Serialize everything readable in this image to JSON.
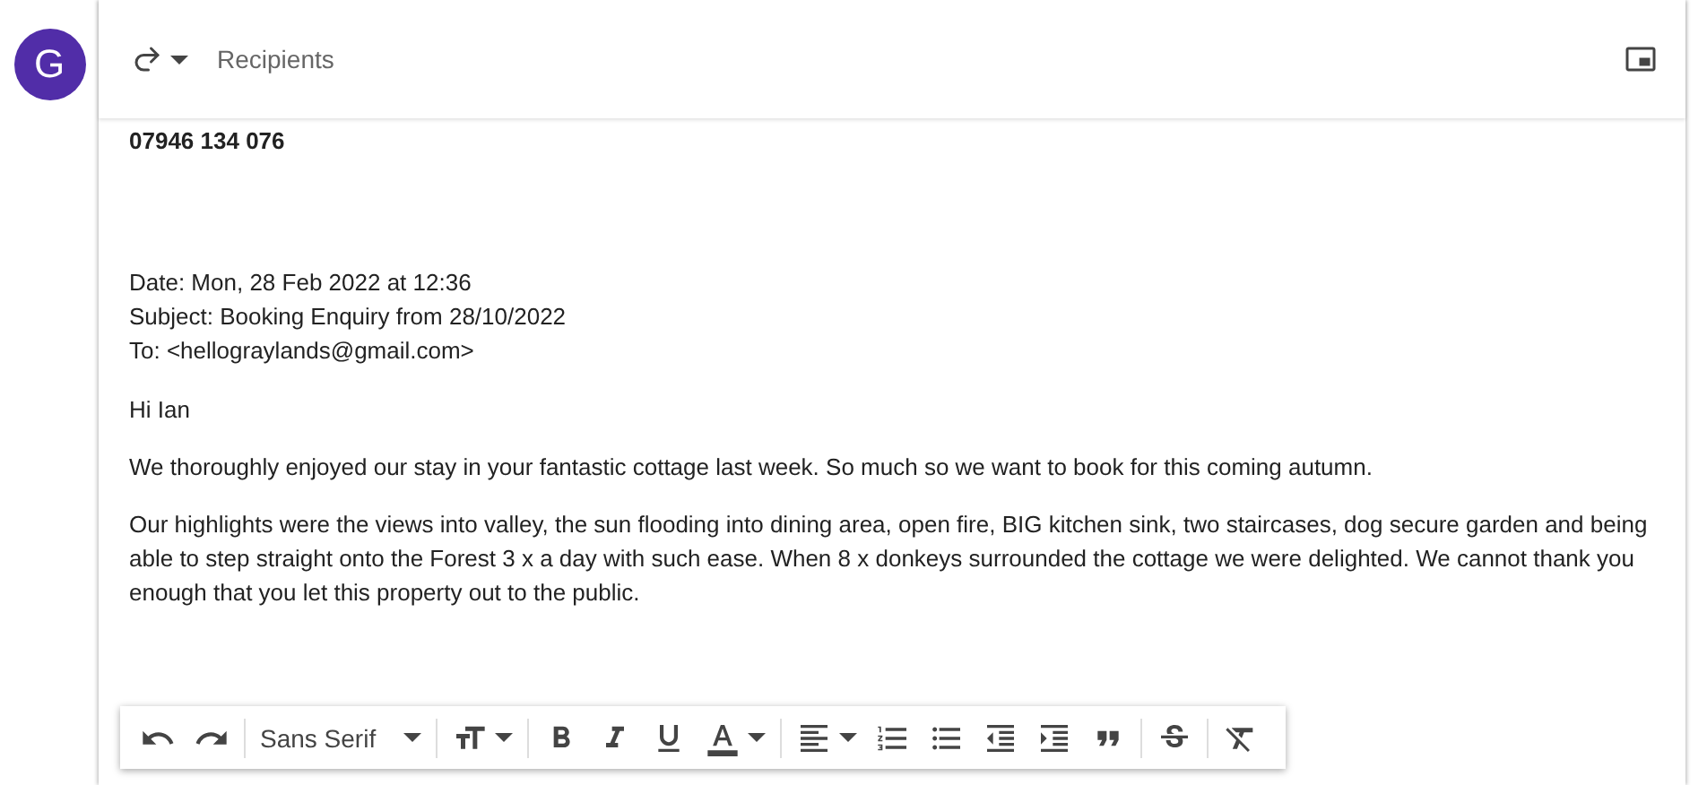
{
  "avatar": {
    "initial": "G"
  },
  "header": {
    "recipients_placeholder": "Recipients"
  },
  "body": {
    "phone": "07946 134 076",
    "meta": [
      "Date: Mon, 28 Feb 2022 at 12:36",
      "Subject: Booking Enquiry from 28/10/2022",
      "To: <hellograylands@gmail.com>"
    ],
    "paragraphs": [
      "Hi Ian",
      "We thoroughly enjoyed our stay in your fantastic cottage last week. So much so we want to book for this coming autumn.",
      "Our highlights were the views into valley, the sun flooding into dining area, open fire, BIG kitchen sink, two staircases, dog secure garden and being able to step straight onto the Forest 3 x a day with such ease. When 8 x donkeys surrounded the cottage we were delighted. We cannot thank you enough that you let this property out to the public."
    ]
  },
  "toolbar": {
    "font": "Sans Serif"
  }
}
